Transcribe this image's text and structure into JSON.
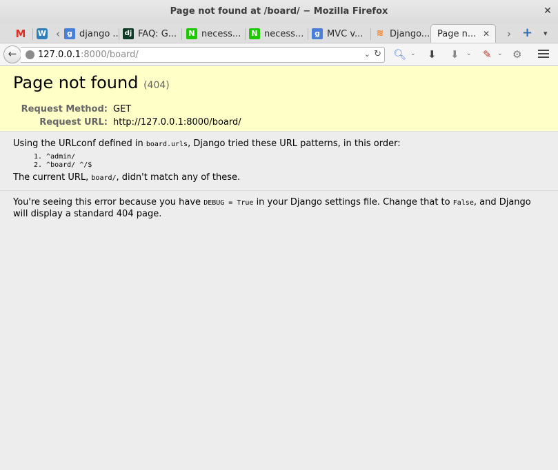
{
  "window": {
    "title": "Page not found at /board/ − Mozilla Firefox"
  },
  "tabs": [
    {
      "label": "",
      "icon": "gmail-icon"
    },
    {
      "label": "",
      "icon": "wordpress-icon"
    },
    {
      "label": "django ...",
      "icon": "google-icon"
    },
    {
      "label": "FAQ: G...",
      "icon": "django-icon"
    },
    {
      "label": "necess...",
      "icon": "naver-icon"
    },
    {
      "label": "necess...",
      "icon": "naver-icon"
    },
    {
      "label": "MVC v...",
      "icon": "google-icon"
    },
    {
      "label": "Django...",
      "icon": "stackoverflow-icon"
    },
    {
      "label": "Page n...",
      "icon": "",
      "active": true
    }
  ],
  "navbar": {
    "url_host": "127.0.0.1",
    "url_rest": ":8000/board/"
  },
  "page": {
    "heading": "Page not found",
    "status_code": "(404)",
    "request_method_label": "Request Method:",
    "request_method": "GET",
    "request_url_label": "Request URL:",
    "request_url": "http://127.0.0.1:8000/board/",
    "urlconf_text_before": "Using the URLconf defined in ",
    "urlconf_module": "board.urls",
    "urlconf_text_after": ", Django tried these URL patterns, in this order:",
    "patterns": [
      "1.  ^admin/",
      "2.  ^board/ ^/$"
    ],
    "current_url_before": "The current URL, ",
    "current_url": "board/",
    "current_url_after": ", didn't match any of these.",
    "debug_before": "You're seeing this error because you have ",
    "debug_setting": "DEBUG = True",
    "debug_middle": " in your Django settings file. Change that to ",
    "debug_false": "False",
    "debug_after": ", and Django will display a standard 404 page."
  },
  "colors": {
    "summary_bg": "#ffffc8",
    "page_bg": "#ededed"
  }
}
